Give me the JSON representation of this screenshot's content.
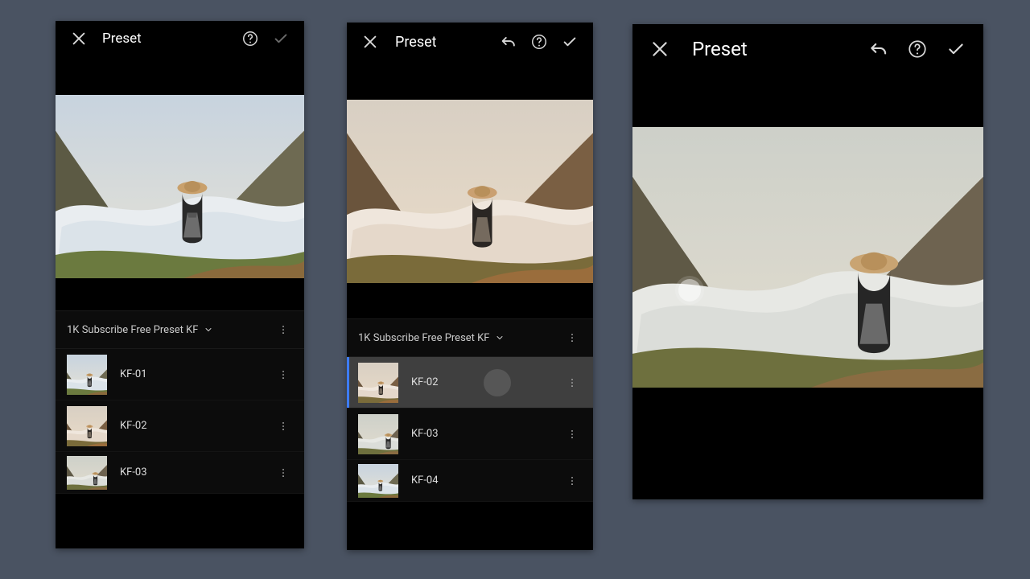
{
  "panels": [
    {
      "title": "Preset",
      "group": "1K Subscribe Free Preset KF",
      "presets": [
        {
          "label": "KF-01",
          "selected": false
        },
        {
          "label": "KF-02",
          "selected": false
        },
        {
          "label": "KF-03",
          "selected": false
        }
      ],
      "toolbar": {
        "undo": false,
        "confirm_dim": true
      }
    },
    {
      "title": "Preset",
      "group": "1K Subscribe Free Preset KF",
      "presets": [
        {
          "label": "KF-02",
          "selected": true
        },
        {
          "label": "KF-03",
          "selected": false
        },
        {
          "label": "KF-04",
          "selected": false
        }
      ],
      "toolbar": {
        "undo": true,
        "confirm_dim": false
      }
    },
    {
      "title": "Preset",
      "group": null,
      "presets": [],
      "toolbar": {
        "undo": true,
        "confirm_dim": false
      }
    }
  ]
}
